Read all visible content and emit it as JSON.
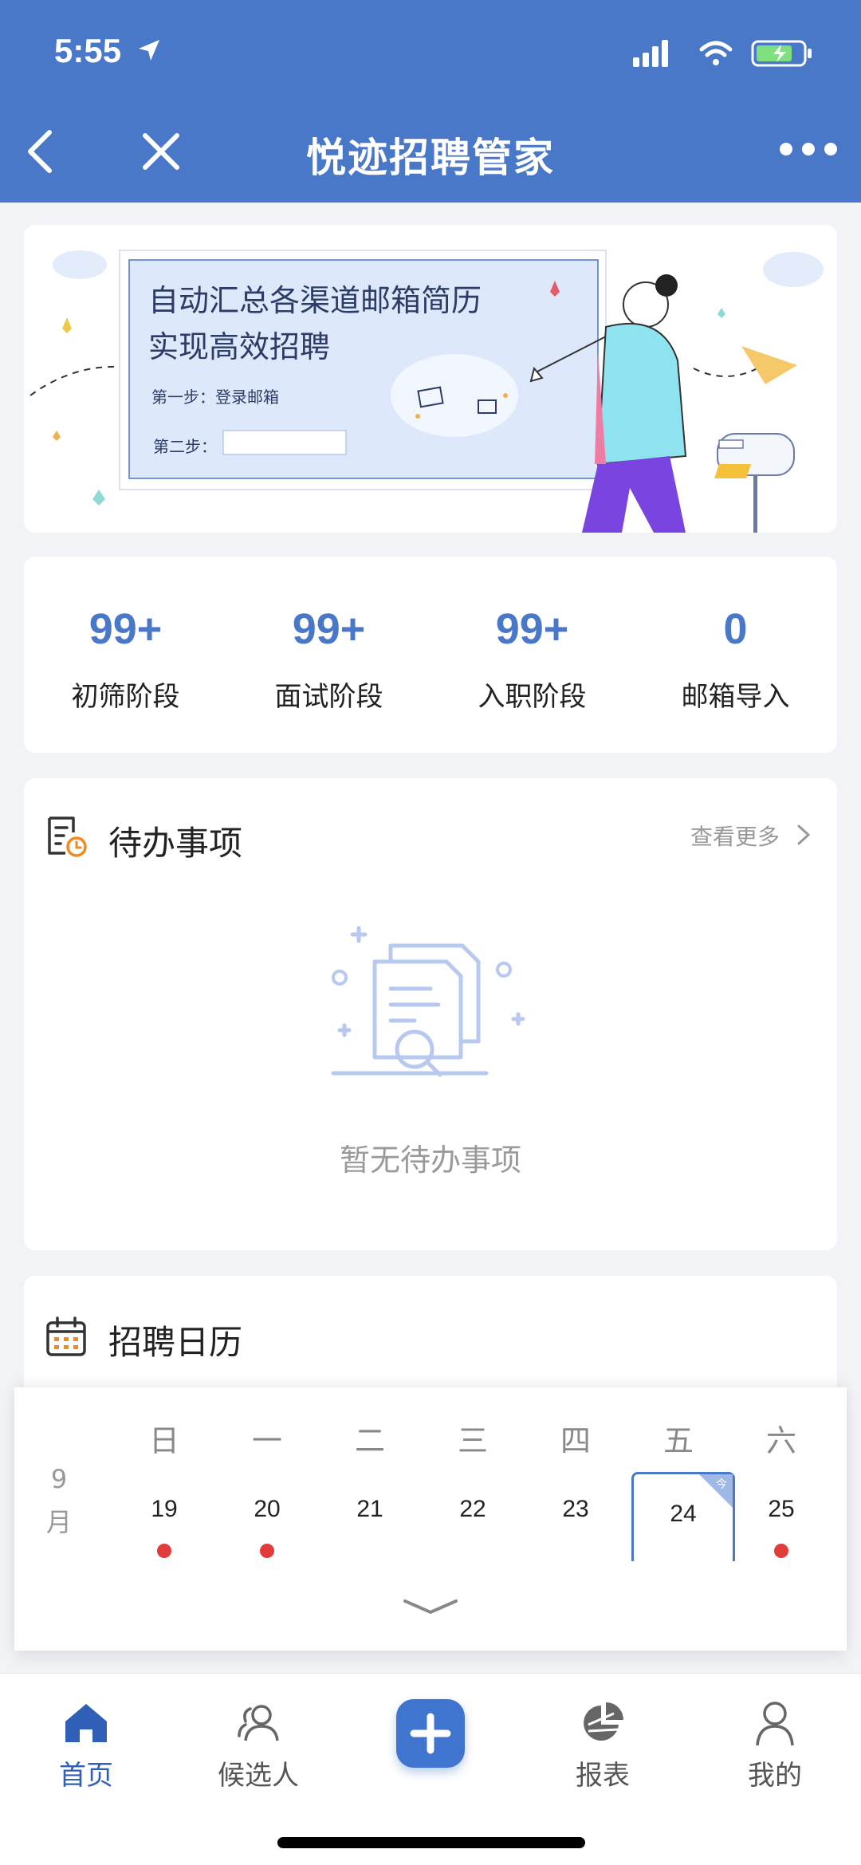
{
  "status": {
    "time": "5:55"
  },
  "nav": {
    "title": "悦迹招聘管家"
  },
  "banner": {
    "title_line1": "自动汇总各渠道邮箱简历",
    "title_line2": "实现高效招聘",
    "step1": "第一步：登录邮箱",
    "step2": "第二步："
  },
  "stats": [
    {
      "value": "99+",
      "label": "初筛阶段"
    },
    {
      "value": "99+",
      "label": "面试阶段"
    },
    {
      "value": "99+",
      "label": "入职阶段"
    },
    {
      "value": "0",
      "label": "邮箱导入"
    }
  ],
  "todo": {
    "title": "待办事项",
    "more": "查看更多",
    "empty": "暂无待办事项"
  },
  "calendar": {
    "title": "招聘日历",
    "weekdays": [
      "日",
      "一",
      "二",
      "三",
      "四",
      "五",
      "六"
    ],
    "month_line1": "9",
    "month_line2": "月",
    "days": [
      "19",
      "20",
      "21",
      "22",
      "23",
      "24",
      "25"
    ],
    "today_tag": "今"
  },
  "tabbar": {
    "home": "首页",
    "candidates": "候选人",
    "reports": "报表",
    "mine": "我的"
  },
  "colors": {
    "accent": "#4a78c9",
    "event_dot": "#e23b3b"
  }
}
